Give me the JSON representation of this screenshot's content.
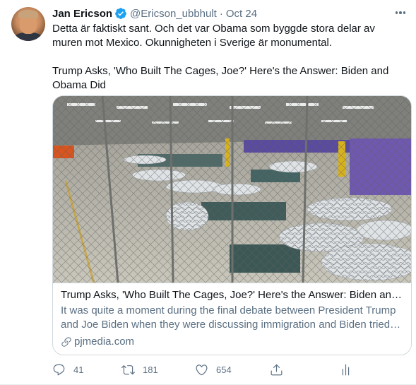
{
  "tweet": {
    "author_name": "Jan Ericson",
    "handle": "@Ericson_ubbhult",
    "separator": "·",
    "date": "Oct 24",
    "verified": true,
    "text_line1": "Detta är faktiskt sant. Och det var Obama som byggde stora delar av muren mot Mexico. Okunnigheten i Sverige är monumental.",
    "text_line2": "Trump Asks, 'Who Built The Cages, Joe?' Here's the Answer: Biden and Obama Did"
  },
  "card": {
    "title": "Trump Asks, 'Who Built The Cages, Joe?' Here's the Answer: Biden and ...",
    "description": "It was quite a moment during the final debate between President Trump and Joe Biden when they were discussing immigration and Biden tried t...",
    "domain": "pjmedia.com"
  },
  "actions": {
    "reply_count": "41",
    "retweet_count": "181",
    "like_count": "654"
  },
  "colors": {
    "verified_blue": "#1da1f2",
    "secondary_text": "#5b7083",
    "border": "#cfd9de"
  },
  "icons": [
    "verified-badge-icon",
    "more-icon",
    "link-icon",
    "reply-icon",
    "retweet-icon",
    "like-icon",
    "share-icon",
    "analytics-icon"
  ]
}
